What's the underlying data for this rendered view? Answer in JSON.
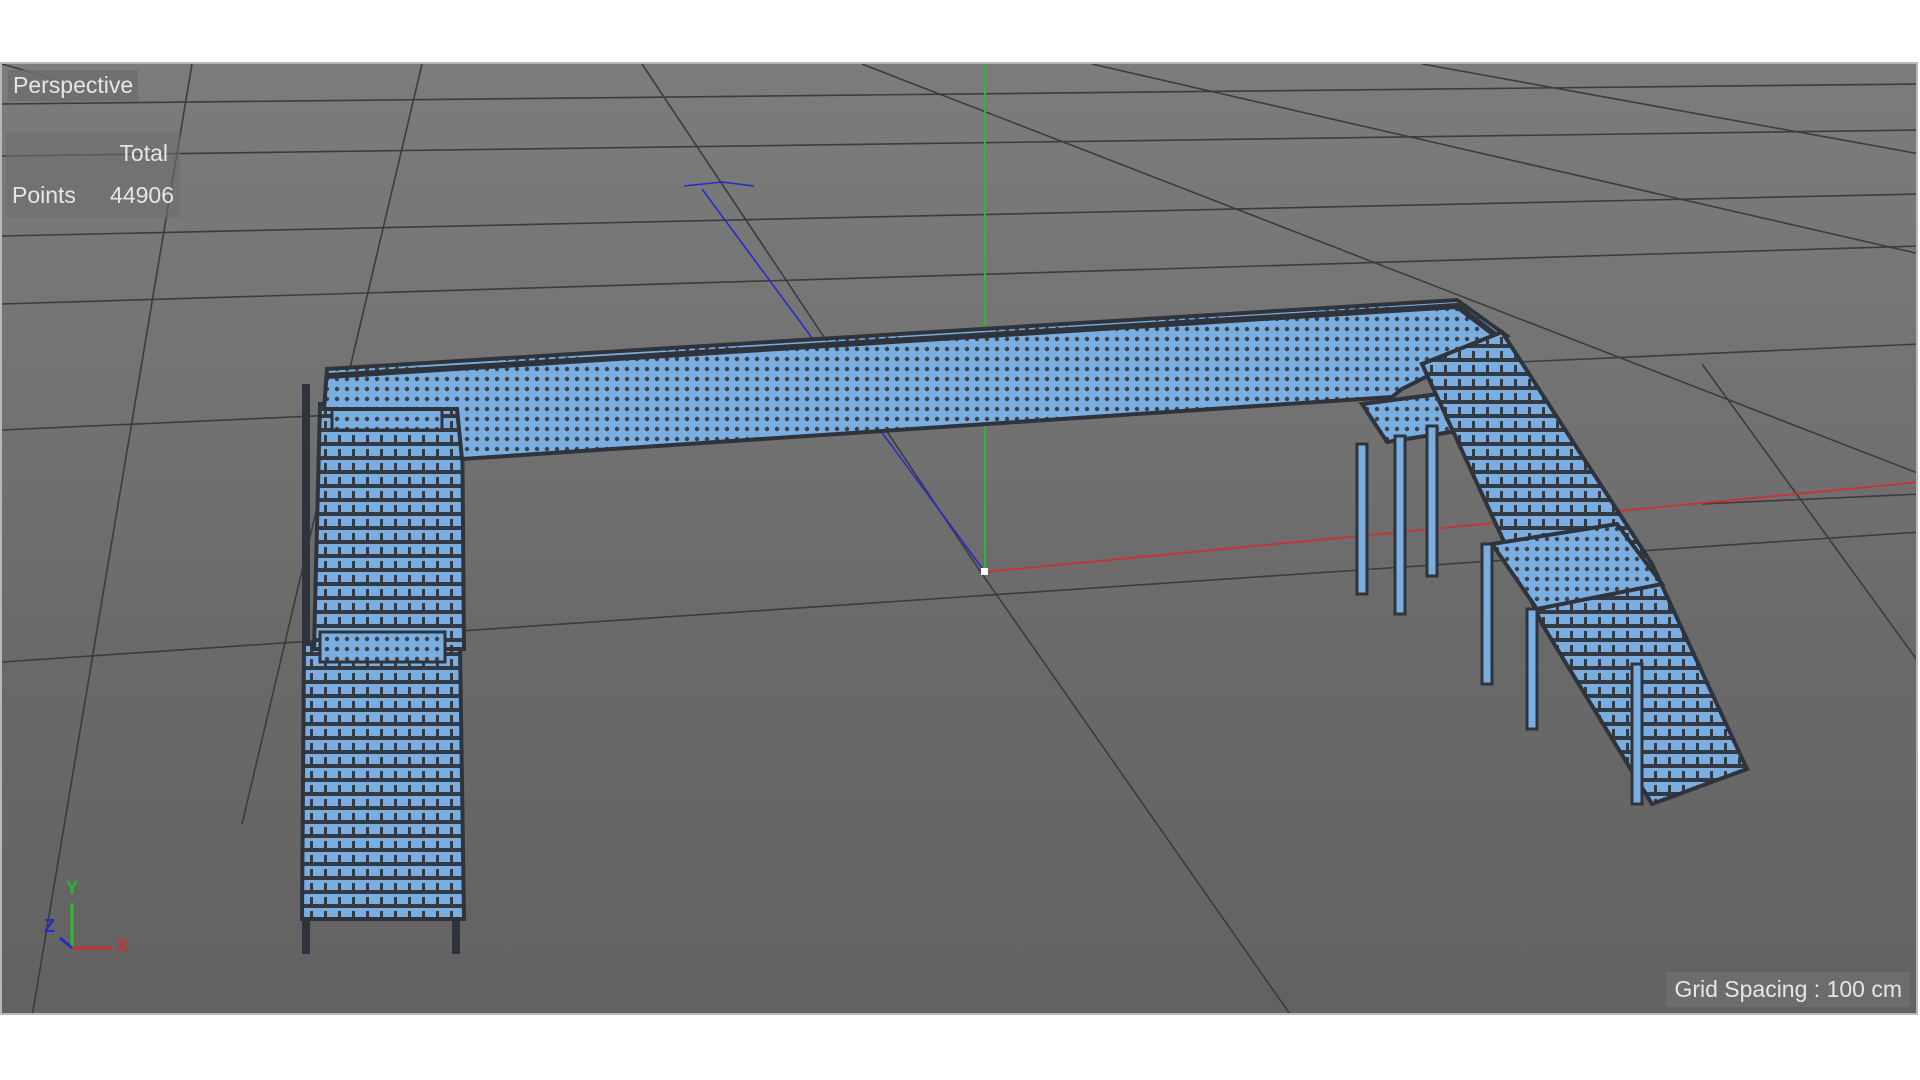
{
  "viewport": {
    "view_name": "Perspective",
    "stats": {
      "column_header": "Total",
      "row_label": "Points",
      "row_value": "44906"
    },
    "grid_spacing": "Grid Spacing : 100 cm"
  },
  "axis_gizmo": {
    "y": "Y",
    "z": "Z",
    "x": "X"
  },
  "colors": {
    "viewport_bg": "#6f6f6f",
    "model_fill": "#7aaee0",
    "model_wire": "#333a44",
    "x_axis": "#c83232",
    "y_axis": "#2fb82f",
    "z_axis": "#2a2ac8"
  },
  "icons": [
    "axis-gizmo-icon",
    "world-origin-icon"
  ]
}
